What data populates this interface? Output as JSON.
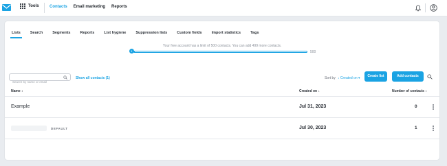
{
  "topnav": {
    "tools_label": "Tools",
    "items": [
      {
        "label": "Contacts",
        "active": true
      },
      {
        "label": "Email marketing",
        "active": false
      },
      {
        "label": "Reports",
        "active": false
      }
    ]
  },
  "tabs": [
    "Lists",
    "Search",
    "Segments",
    "Reports",
    "List hygiene",
    "Suppression lists",
    "Custom fields",
    "Import statistics",
    "Tags"
  ],
  "active_tab": "Lists",
  "limit": {
    "text": "Your free account has a limit of 500 contacts. You can add 499 more contacts.",
    "knob_label": "1",
    "max_label": "500",
    "used_fraction": 0.002
  },
  "search": {
    "placeholder": "Search by name or email",
    "show_all_label": "Show all contacts (1)"
  },
  "sort": {
    "label": "Sort by",
    "value": "Created on"
  },
  "buttons": {
    "create_list": "Create list",
    "add_contacts": "Add contacts"
  },
  "table": {
    "columns": {
      "name": "Name",
      "created_on": "Created on",
      "contacts": "Number of contacts"
    },
    "rows": [
      {
        "name": "Example",
        "created_on": "Jul 31, 2023",
        "contacts": "0",
        "badge": ""
      },
      {
        "name": "",
        "created_on": "Jul 30, 2023",
        "contacts": "1",
        "badge": "DEFAULT"
      }
    ]
  },
  "colors": {
    "accent": "#1aa3e3",
    "text": "#2a2f36",
    "background": "#e9ecf0"
  }
}
